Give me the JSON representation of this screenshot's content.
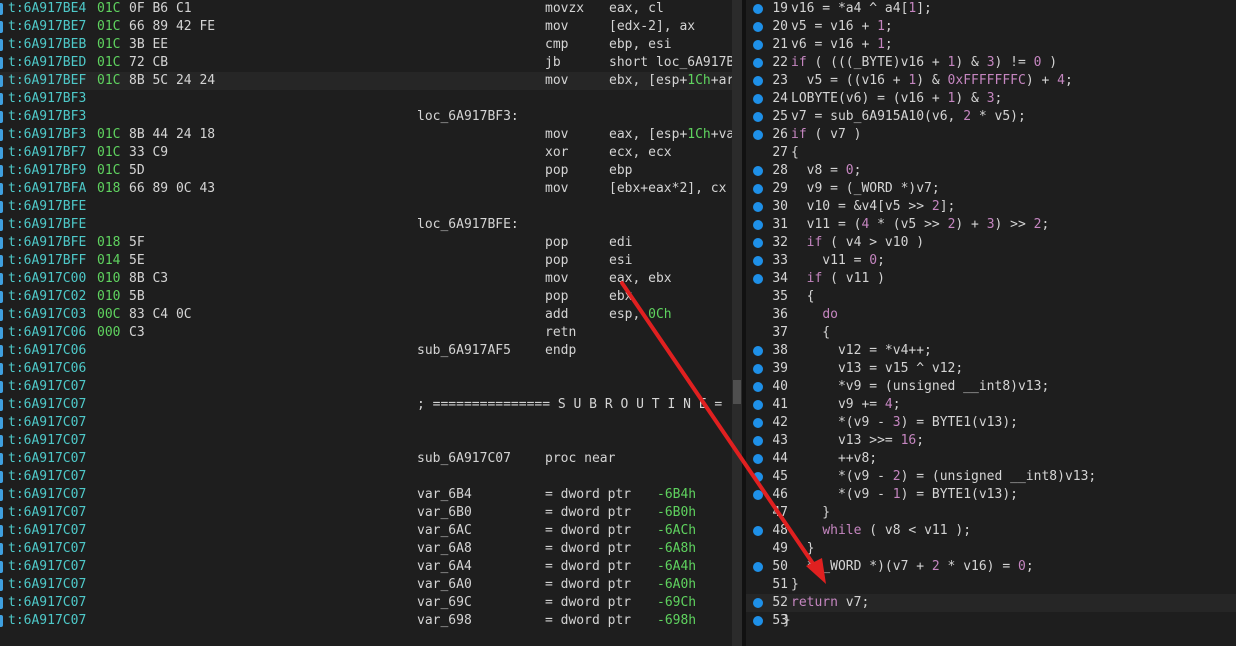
{
  "disasm": {
    "rows": [
      {
        "addr": "t:6A917BE4",
        "sp": "01C",
        "bytes": "0F B6 C1",
        "label": "",
        "mnem": "movzx",
        "op": "eax, cl"
      },
      {
        "addr": "t:6A917BE7",
        "sp": "01C",
        "bytes": "66 89 42 FE",
        "label": "",
        "mnem": "mov",
        "op": "[edx-2], ax"
      },
      {
        "addr": "t:6A917BEB",
        "sp": "01C",
        "bytes": "3B EE",
        "label": "",
        "mnem": "cmp",
        "op": "ebp, esi"
      },
      {
        "addr": "t:6A917BED",
        "sp": "01C",
        "bytes": "72 CB",
        "label": "",
        "mnem": "jb",
        "op": "short loc_6A917B"
      },
      {
        "addr": "t:6A917BEF",
        "sp": "01C",
        "bytes": "8B 5C 24 24",
        "label": "",
        "mnem": "mov",
        "op": "ebx, [esp+1Ch+ar"
      },
      {
        "addr": "t:6A917BF3",
        "sp": "",
        "bytes": "",
        "label": "",
        "mnem": "",
        "op": ""
      },
      {
        "addr": "t:6A917BF3",
        "sp": "",
        "bytes": "",
        "label": "loc_6A917BF3:",
        "mnem": "",
        "op": ""
      },
      {
        "addr": "t:6A917BF3",
        "sp": "01C",
        "bytes": "8B 44 24 18",
        "label": "",
        "mnem": "mov",
        "op": "eax, [esp+1Ch+va"
      },
      {
        "addr": "t:6A917BF7",
        "sp": "01C",
        "bytes": "33 C9",
        "label": "",
        "mnem": "xor",
        "op": "ecx, ecx"
      },
      {
        "addr": "t:6A917BF9",
        "sp": "01C",
        "bytes": "5D",
        "label": "",
        "mnem": "pop",
        "op": "ebp"
      },
      {
        "addr": "t:6A917BFA",
        "sp": "018",
        "bytes": "66 89 0C 43",
        "label": "",
        "mnem": "mov",
        "op": "[ebx+eax*2], cx"
      },
      {
        "addr": "t:6A917BFE",
        "sp": "",
        "bytes": "",
        "label": "",
        "mnem": "",
        "op": ""
      },
      {
        "addr": "t:6A917BFE",
        "sp": "",
        "bytes": "",
        "label": "loc_6A917BFE:",
        "mnem": "",
        "op": ""
      },
      {
        "addr": "t:6A917BFE",
        "sp": "018",
        "bytes": "5F",
        "label": "",
        "mnem": "pop",
        "op": "edi"
      },
      {
        "addr": "t:6A917BFF",
        "sp": "014",
        "bytes": "5E",
        "label": "",
        "mnem": "pop",
        "op": "esi"
      },
      {
        "addr": "t:6A917C00",
        "sp": "010",
        "bytes": "8B C3",
        "label": "",
        "mnem": "mov",
        "op": "eax, ebx"
      },
      {
        "addr": "t:6A917C02",
        "sp": "010",
        "bytes": "5B",
        "label": "",
        "mnem": "pop",
        "op": "ebx"
      },
      {
        "addr": "t:6A917C03",
        "sp": "00C",
        "bytes": "83 C4 0C",
        "label": "",
        "mnem": "add",
        "op": "esp, 0Ch"
      },
      {
        "addr": "t:6A917C06",
        "sp": "000",
        "bytes": "C3",
        "label": "",
        "mnem": "retn",
        "op": ""
      },
      {
        "addr": "t:6A917C06",
        "sp": "",
        "bytes": "",
        "label": "sub_6A917AF5",
        "mnem": "endp",
        "op": ""
      },
      {
        "addr": "t:6A917C06",
        "sp": "",
        "bytes": "",
        "label": "",
        "mnem": "",
        "op": ""
      },
      {
        "addr": "t:6A917C07",
        "sp": "",
        "bytes": "",
        "label": "",
        "mnem": "",
        "op": ""
      },
      {
        "addr": "t:6A917C07",
        "sp": "",
        "bytes": "",
        "label": "; =============== S U B R O U T I N E =",
        "mnem": "",
        "op": ""
      },
      {
        "addr": "t:6A917C07",
        "sp": "",
        "bytes": "",
        "label": "",
        "mnem": "",
        "op": ""
      },
      {
        "addr": "t:6A917C07",
        "sp": "",
        "bytes": "",
        "label": "",
        "mnem": "",
        "op": ""
      },
      {
        "addr": "t:6A917C07",
        "sp": "",
        "bytes": "",
        "label": "sub_6A917C07",
        "mnem": "proc near",
        "op": ""
      },
      {
        "addr": "t:6A917C07",
        "sp": "",
        "bytes": "",
        "label": "",
        "mnem": "",
        "op": ""
      },
      {
        "addr": "t:6A917C07",
        "sp": "",
        "bytes": "",
        "label": "var_6B4",
        "mnem": "= dword ptr",
        "op": "-6B4h"
      },
      {
        "addr": "t:6A917C07",
        "sp": "",
        "bytes": "",
        "label": "var_6B0",
        "mnem": "= dword ptr",
        "op": "-6B0h"
      },
      {
        "addr": "t:6A917C07",
        "sp": "",
        "bytes": "",
        "label": "var_6AC",
        "mnem": "= dword ptr",
        "op": "-6ACh"
      },
      {
        "addr": "t:6A917C07",
        "sp": "",
        "bytes": "",
        "label": "var_6A8",
        "mnem": "= dword ptr",
        "op": "-6A8h"
      },
      {
        "addr": "t:6A917C07",
        "sp": "",
        "bytes": "",
        "label": "var_6A4",
        "mnem": "= dword ptr",
        "op": "-6A4h"
      },
      {
        "addr": "t:6A917C07",
        "sp": "",
        "bytes": "",
        "label": "var_6A0",
        "mnem": "= dword ptr",
        "op": "-6A0h"
      },
      {
        "addr": "t:6A917C07",
        "sp": "",
        "bytes": "",
        "label": "var_69C",
        "mnem": "= dword ptr",
        "op": "-69Ch"
      },
      {
        "addr": "t:6A917C07",
        "sp": "",
        "bytes": "",
        "label": "var_698",
        "mnem": "= dword ptr",
        "op": "-698h"
      }
    ]
  },
  "pseudocode": {
    "lines": [
      {
        "n": "19",
        "dot": true,
        "code": "v16 = *a4 ^ a4[1];"
      },
      {
        "n": "20",
        "dot": true,
        "code": "v5 = v16 + 1;"
      },
      {
        "n": "21",
        "dot": true,
        "code": "v6 = v16 + 1;"
      },
      {
        "n": "22",
        "dot": true,
        "code": "if ( (((_BYTE)v16 + 1) & 3) != 0 )"
      },
      {
        "n": "23",
        "dot": true,
        "code": "  v5 = ((v16 + 1) & 0xFFFFFFFC) + 4;"
      },
      {
        "n": "24",
        "dot": true,
        "code": "LOBYTE(v6) = (v16 + 1) & 3;"
      },
      {
        "n": "25",
        "dot": true,
        "code": "v7 = sub_6A915A10(v6, 2 * v5);"
      },
      {
        "n": "26",
        "dot": true,
        "code": "if ( v7 )"
      },
      {
        "n": "27",
        "dot": false,
        "code": "{"
      },
      {
        "n": "28",
        "dot": true,
        "code": "  v8 = 0;"
      },
      {
        "n": "29",
        "dot": true,
        "code": "  v9 = (_WORD *)v7;"
      },
      {
        "n": "30",
        "dot": true,
        "code": "  v10 = &v4[v5 >> 2];"
      },
      {
        "n": "31",
        "dot": true,
        "code": "  v11 = (4 * (v5 >> 2) + 3) >> 2;"
      },
      {
        "n": "32",
        "dot": true,
        "code": "  if ( v4 > v10 )"
      },
      {
        "n": "33",
        "dot": true,
        "code": "    v11 = 0;"
      },
      {
        "n": "34",
        "dot": true,
        "code": "  if ( v11 )"
      },
      {
        "n": "35",
        "dot": false,
        "code": "  {"
      },
      {
        "n": "36",
        "dot": false,
        "code": "    do"
      },
      {
        "n": "37",
        "dot": false,
        "code": "    {"
      },
      {
        "n": "38",
        "dot": true,
        "code": "      v12 = *v4++;"
      },
      {
        "n": "39",
        "dot": true,
        "code": "      v13 = v15 ^ v12;"
      },
      {
        "n": "40",
        "dot": true,
        "code": "      *v9 = (unsigned __int8)v13;"
      },
      {
        "n": "41",
        "dot": true,
        "code": "      v9 += 4;"
      },
      {
        "n": "42",
        "dot": true,
        "code": "      *(v9 - 3) = BYTE1(v13);"
      },
      {
        "n": "43",
        "dot": true,
        "code": "      v13 >>= 16;"
      },
      {
        "n": "44",
        "dot": true,
        "code": "      ++v8;"
      },
      {
        "n": "45",
        "dot": true,
        "code": "      *(v9 - 2) = (unsigned __int8)v13;"
      },
      {
        "n": "46",
        "dot": true,
        "code": "      *(v9 - 1) = BYTE1(v13);"
      },
      {
        "n": "47",
        "dot": false,
        "code": "    }"
      },
      {
        "n": "48",
        "dot": true,
        "code": "    while ( v8 < v11 );"
      },
      {
        "n": "49",
        "dot": false,
        "code": "  }"
      },
      {
        "n": "50",
        "dot": true,
        "code": "  *(_WORD *)(v7 + 2 * v16) = 0;"
      },
      {
        "n": "51",
        "dot": false,
        "code": "}"
      },
      {
        "n": "52",
        "dot": true,
        "code": "return v7;"
      },
      {
        "n": "53",
        "dot": true,
        "code": "}"
      }
    ]
  },
  "colors": {
    "background": "#1e1e1e",
    "address": "#4ec9c9",
    "stack_pointer": "#5fd35f",
    "keyword": "#c586c0",
    "breakpoint_dot": "#1e90e8",
    "annotation_arrow": "#e02020"
  },
  "icons": {
    "breakpoint": "breakpoint-dot-icon",
    "annotation": "red-arrow-annotation"
  }
}
